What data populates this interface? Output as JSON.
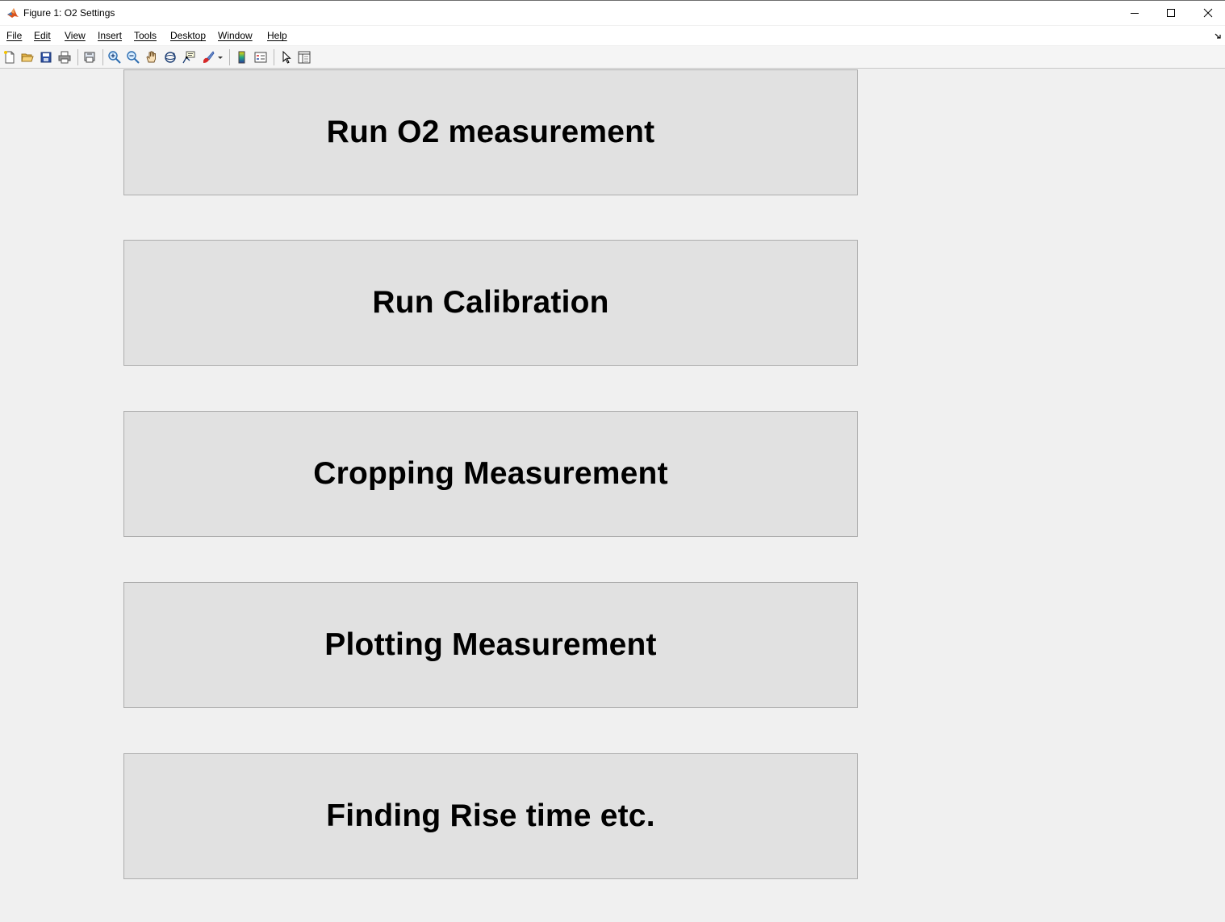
{
  "window": {
    "title": "Figure 1: O2 Settings"
  },
  "menubar": {
    "items": [
      {
        "label": "File"
      },
      {
        "label": "Edit"
      },
      {
        "label": "View"
      },
      {
        "label": "Insert"
      },
      {
        "label": "Tools"
      },
      {
        "label": "Desktop"
      },
      {
        "label": "Window"
      },
      {
        "label": "Help"
      }
    ]
  },
  "toolbar": {
    "icons": [
      "new-figure-icon",
      "open-file-icon",
      "save-icon",
      "print-icon",
      "print-preview-icon",
      "zoom-in-icon",
      "zoom-out-icon",
      "pan-icon",
      "rotate-3d-icon",
      "data-cursor-icon",
      "brush-icon",
      "colorbar-icon",
      "legend-icon",
      "edit-plot-icon",
      "property-inspector-icon"
    ]
  },
  "buttons": [
    {
      "label": "Run O2 measurement"
    },
    {
      "label": "Run Calibration"
    },
    {
      "label": "Cropping Measurement"
    },
    {
      "label": "Plotting Measurement"
    },
    {
      "label": "Finding Rise time etc."
    }
  ],
  "colors": {
    "background": "#f0f0f0",
    "button_face": "#e1e1e1",
    "button_border": "#adadad"
  }
}
